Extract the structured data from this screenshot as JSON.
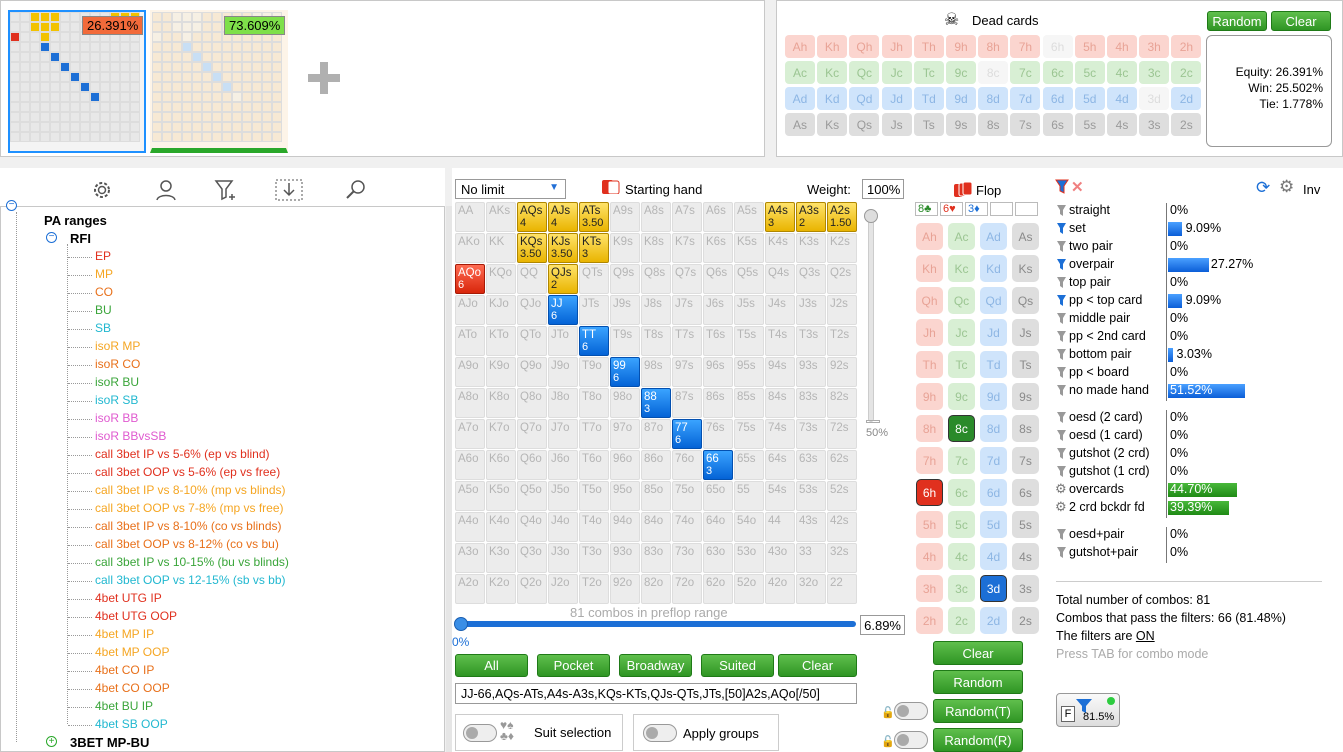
{
  "players": [
    {
      "equity": "26.391%",
      "color": "#f26a3a"
    },
    {
      "equity": "73.609%",
      "color": "#7ee04a"
    }
  ],
  "dead_cards": {
    "title": "Dead cards",
    "random_label": "Random",
    "clear_label": "Clear",
    "rows": [
      [
        "Ah",
        "Kh",
        "Qh",
        "Jh",
        "Th",
        "9h",
        "8h",
        "7h",
        "6h",
        "5h",
        "4h",
        "3h",
        "2h"
      ],
      [
        "Ac",
        "Kc",
        "Qc",
        "Jc",
        "Tc",
        "9c",
        "8c",
        "7c",
        "6c",
        "5c",
        "4c",
        "3c",
        "2c"
      ],
      [
        "Ad",
        "Kd",
        "Qd",
        "Jd",
        "Td",
        "9d",
        "8d",
        "7d",
        "6d",
        "5d",
        "4d",
        "3d",
        "2d"
      ],
      [
        "As",
        "Ks",
        "Qs",
        "Js",
        "Ts",
        "9s",
        "8s",
        "7s",
        "6s",
        "5s",
        "4s",
        "3s",
        "2s"
      ]
    ],
    "used": [
      "6h",
      "8c",
      "3d"
    ],
    "equity_label": "Equity: 26.391%",
    "win_label": "Win: 25.502%",
    "tie_label": "Tie: 1.778%"
  },
  "tree": {
    "root": "PA ranges",
    "group": "RFI",
    "items": [
      {
        "label": "EP",
        "color": "#e0301e"
      },
      {
        "label": "MP",
        "color": "#f5a623"
      },
      {
        "label": "CO",
        "color": "#e8701a"
      },
      {
        "label": "BU",
        "color": "#3aa53a"
      },
      {
        "label": "SB",
        "color": "#22b8d0"
      },
      {
        "label": "isoR MP",
        "color": "#f5a623"
      },
      {
        "label": "isoR CO",
        "color": "#e8701a"
      },
      {
        "label": "isoR BU",
        "color": "#3aa53a"
      },
      {
        "label": "isoR SB",
        "color": "#22b8d0"
      },
      {
        "label": "isoR BB",
        "color": "#e05ad0"
      },
      {
        "label": "isoR BBvsSB",
        "color": "#e05ad0"
      },
      {
        "label": "call 3bet IP vs 5-6% (ep vs blind)",
        "color": "#e0301e"
      },
      {
        "label": "call 3bet OOP vs 5-6% (ep vs free)",
        "color": "#e0301e"
      },
      {
        "label": "call 3bet IP vs 8-10% (mp vs blinds)",
        "color": "#f5a623"
      },
      {
        "label": "call 3bet OOP vs 7-8% (mp vs free)",
        "color": "#f5a623"
      },
      {
        "label": "call 3bet IP vs 8-10% (co vs blinds)",
        "color": "#e8701a"
      },
      {
        "label": "call 3bet OOP vs 8-12% (co vs bu)",
        "color": "#e8701a"
      },
      {
        "label": "call 3bet IP vs 10-15% (bu vs blinds)",
        "color": "#3aa53a"
      },
      {
        "label": "call 3bet OOP vs 12-15% (sb vs bb)",
        "color": "#22b8d0"
      },
      {
        "label": "4bet UTG IP",
        "color": "#e0301e"
      },
      {
        "label": "4bet UTG OOP",
        "color": "#e0301e"
      },
      {
        "label": "4bet MP IP",
        "color": "#f5a623"
      },
      {
        "label": "4bet MP OOP",
        "color": "#f5a623"
      },
      {
        "label": "4bet CO IP",
        "color": "#e8701a"
      },
      {
        "label": "4bet CO OOP",
        "color": "#e8701a"
      },
      {
        "label": "4bet BU IP",
        "color": "#3aa53a"
      },
      {
        "label": "4bet SB OOP",
        "color": "#22b8d0"
      }
    ],
    "next_group": "3BET MP-BU"
  },
  "range": {
    "limit": "No limit",
    "starting_hand_label": "Starting hand",
    "weight_label": "Weight:",
    "weight_value": "100%",
    "slider_pct": "50%",
    "combos_text": "81 combos in preflop range",
    "progress_start": "0%",
    "progress_value": "6.89%",
    "buttons": [
      "All",
      "Pocket",
      "Broadway",
      "Suited",
      "Clear"
    ],
    "range_text": "JJ-66,AQs-ATs,A4s-A3s,KQs-KTs,QJs-QTs,JTs,[50]A2s,AQo[/50]",
    "suit_selection_label": "Suit selection",
    "apply_groups_label": "Apply groups",
    "ranks": [
      "A",
      "K",
      "Q",
      "J",
      "T",
      "9",
      "8",
      "7",
      "6",
      "5",
      "4",
      "3",
      "2"
    ],
    "selected": {
      "AQs": {
        "c": "y",
        "w": "4"
      },
      "AJs": {
        "c": "y",
        "w": "4"
      },
      "ATs": {
        "c": "y",
        "w": "3.50"
      },
      "A4s": {
        "c": "y",
        "w": "3"
      },
      "A3s": {
        "c": "y",
        "w": "2"
      },
      "A2s": {
        "c": "y",
        "w": "1.50"
      },
      "KQs": {
        "c": "y",
        "w": "3.50"
      },
      "KJs": {
        "c": "y",
        "w": "3.50"
      },
      "KTs": {
        "c": "y",
        "w": "3"
      },
      "QJs": {
        "c": "y",
        "w": "2"
      },
      "AQo": {
        "c": "r",
        "w": "6"
      },
      "JJ": {
        "c": "b",
        "w": "6"
      },
      "TT": {
        "c": "b",
        "w": "6"
      },
      "99": {
        "c": "b",
        "w": "6"
      },
      "88": {
        "c": "b",
        "w": "3"
      },
      "77": {
        "c": "b",
        "w": "6"
      },
      "66": {
        "c": "b",
        "w": "3"
      }
    }
  },
  "flop": {
    "title": "Flop",
    "suit_counts": [
      "8♣",
      "6♥",
      "3♦"
    ],
    "ranks": [
      "A",
      "K",
      "Q",
      "J",
      "T",
      "9",
      "8",
      "7",
      "6",
      "5",
      "4",
      "3",
      "2"
    ],
    "selected": [
      "8c",
      "6h",
      "3d"
    ],
    "clear_label": "Clear",
    "random_label": "Random",
    "random_t_label": "Random(T)",
    "random_r_label": "Random(R)"
  },
  "stats": {
    "inv_label": "Inv",
    "made": [
      {
        "label": "straight",
        "pct": "0%",
        "val": 0
      },
      {
        "label": "set",
        "pct": "9.09%",
        "val": 9.09,
        "active": true
      },
      {
        "label": "two pair",
        "pct": "0%",
        "val": 0
      },
      {
        "label": "overpair",
        "pct": "27.27%",
        "val": 27.27,
        "active": true
      },
      {
        "label": "top pair",
        "pct": "0%",
        "val": 0
      },
      {
        "label": "pp < top card",
        "pct": "9.09%",
        "val": 9.09,
        "active": true
      },
      {
        "label": "middle pair",
        "pct": "0%",
        "val": 0
      },
      {
        "label": "pp < 2nd card",
        "pct": "0%",
        "val": 0
      },
      {
        "label": "bottom pair",
        "pct": "3.03%",
        "val": 3.03
      },
      {
        "label": "pp < board",
        "pct": "0%",
        "val": 0
      },
      {
        "label": "no made hand",
        "pct": "51.52%",
        "val": 51.52
      }
    ],
    "draws": [
      {
        "label": "oesd (2 card)",
        "pct": "0%",
        "val": 0
      },
      {
        "label": "oesd (1 card)",
        "pct": "0%",
        "val": 0
      },
      {
        "label": "gutshot (2 crd)",
        "pct": "0%",
        "val": 0
      },
      {
        "label": "gutshot (1 crd)",
        "pct": "0%",
        "val": 0
      },
      {
        "label": "overcards",
        "pct": "44.70%",
        "val": 44.7,
        "green": true
      },
      {
        "label": "2 crd bckdr fd",
        "pct": "39.39%",
        "val": 39.39,
        "green": true
      }
    ],
    "combo": [
      {
        "label": "oesd+pair",
        "pct": "0%"
      },
      {
        "label": "gutshot+pair",
        "pct": "0%"
      }
    ],
    "total_combos": "Total number of combos: 81",
    "pass_filters": "Combos that pass the filters: 66 (81.48%)",
    "filters_prefix": "The filters are ",
    "filters_state": "ON",
    "tab_hint": "Press TAB for combo mode",
    "filter_badge": "81.5%"
  }
}
